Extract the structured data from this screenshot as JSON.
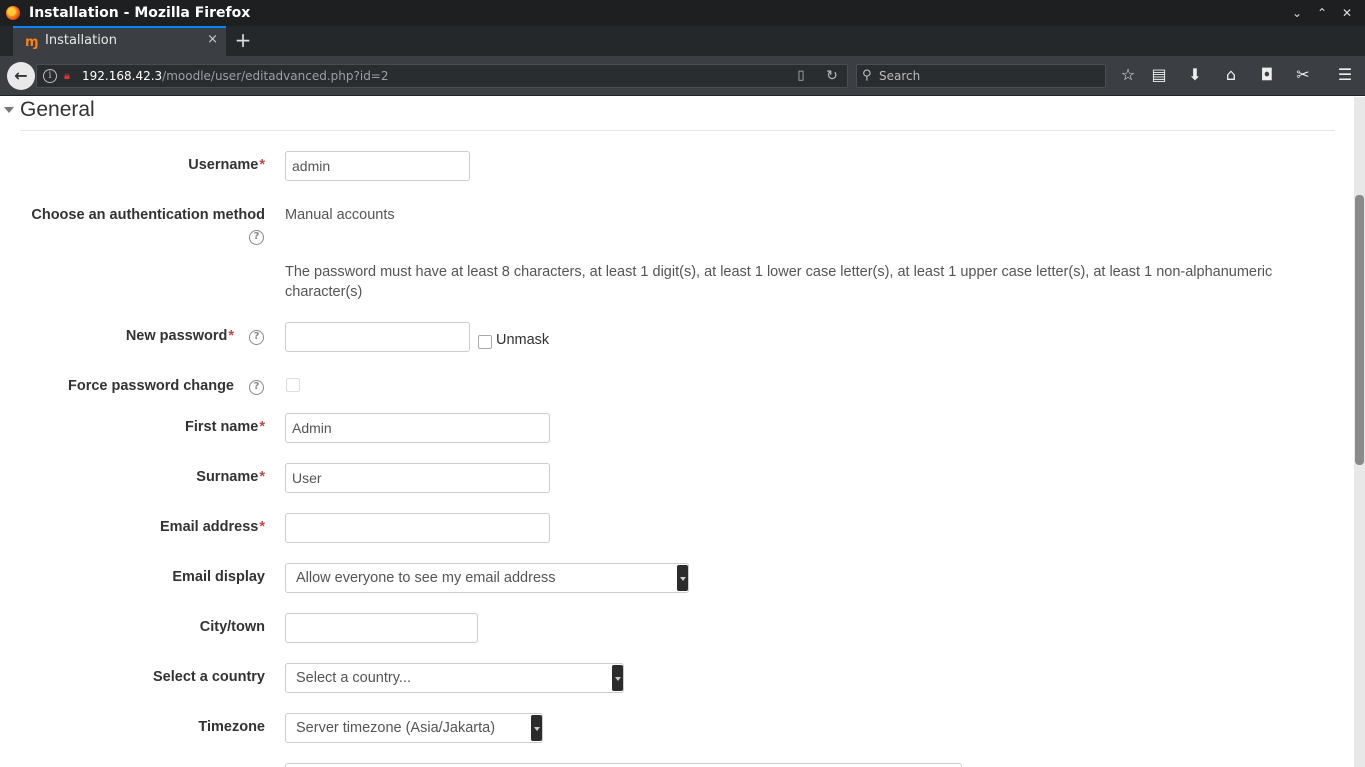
{
  "window": {
    "title": "Installation - Mozilla Firefox",
    "controls": [
      "⌄",
      "⌃",
      "✕"
    ]
  },
  "tab": {
    "label": "Installation",
    "favicon": "moodle-icon",
    "close": "×",
    "new_tab": "+"
  },
  "nav": {
    "url_host": "192.168.42.3",
    "url_path": "/moodle/user/editadvanced.php?id=2",
    "search_placeholder": "Search"
  },
  "toolbar_icons": [
    "star-icon",
    "reading-list-icon",
    "download-icon",
    "home-icon",
    "pocket-icon",
    "extensions-icon",
    "menu-icon"
  ],
  "form": {
    "section_title": "General",
    "username": {
      "label": "Username",
      "required_mark": "*",
      "value": "admin"
    },
    "auth": {
      "label": "Choose an authentication method",
      "value": "Manual accounts"
    },
    "password_policy": "The password must have at least 8 characters, at least 1 digit(s), at least 1 lower case letter(s), at least 1 upper case letter(s), at least 1 non-alphanumeric character(s)",
    "new_password": {
      "label": "New password",
      "required_mark": "*",
      "value": "",
      "unmask_label": "Unmask"
    },
    "force_password_change": {
      "label": "Force password change"
    },
    "first_name": {
      "label": "First name",
      "required_mark": "*",
      "value": "Admin"
    },
    "surname": {
      "label": "Surname",
      "required_mark": "*",
      "value": "User"
    },
    "email": {
      "label": "Email address",
      "required_mark": "*",
      "value": ""
    },
    "email_display": {
      "label": "Email display",
      "value": "Allow everyone to see my email address"
    },
    "city": {
      "label": "City/town",
      "value": ""
    },
    "country": {
      "label": "Select a country",
      "value": "Select a country..."
    },
    "timezone": {
      "label": "Timezone",
      "value": "Server timezone (Asia/Jakarta)"
    }
  },
  "colors": {
    "required": "#b94a48",
    "tab_accent": "#0a84ff"
  }
}
